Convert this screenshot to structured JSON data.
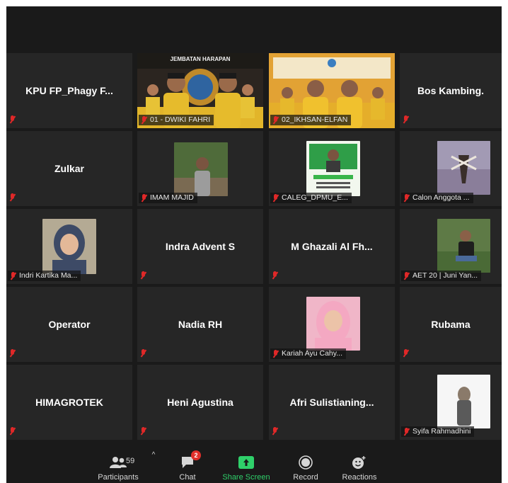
{
  "tiles": [
    {
      "name": "KPU FP_Phagy F...",
      "mode": "center"
    },
    {
      "name": "01 - DWIKI FAHRI",
      "mode": "video",
      "banner": "JEMBATAN HARAPAN"
    },
    {
      "name": "02_IKHSAN-ELFAN",
      "mode": "video2"
    },
    {
      "name": "Bos Kambing.",
      "mode": "center"
    },
    {
      "name": "Zulkar",
      "mode": "center"
    },
    {
      "name": "IMAM MAJID",
      "mode": "photo"
    },
    {
      "name": "CALEG_DPMU_E...",
      "mode": "photo"
    },
    {
      "name": "Calon Anggota ...",
      "mode": "photo"
    },
    {
      "name": "Indri Kartika Ma...",
      "mode": "photo"
    },
    {
      "name": "Indra Advent S",
      "mode": "center"
    },
    {
      "name": "M Ghazali Al Fh...",
      "mode": "center"
    },
    {
      "name": "AET 20 | Juni Yan...",
      "mode": "photo"
    },
    {
      "name": "Operator",
      "mode": "center"
    },
    {
      "name": "Nadia RH",
      "mode": "center"
    },
    {
      "name": "Kariah Ayu Cahy...",
      "mode": "photo"
    },
    {
      "name": "Rubama",
      "mode": "center"
    },
    {
      "name": "HIMAGROTEK",
      "mode": "center"
    },
    {
      "name": "Heni Agustina",
      "mode": "center"
    },
    {
      "name": "Afri Sulistianing...",
      "mode": "center"
    },
    {
      "name": "Syifa Rahmadhini",
      "mode": "photo"
    }
  ],
  "toolbar": {
    "participants_label": "Participants",
    "participants_count": "59",
    "chat_label": "Chat",
    "chat_badge": "2",
    "share_label": "Share Screen",
    "record_label": "Record",
    "reactions_label": "Reactions"
  },
  "colors": {
    "share_accent": "#2fd06a",
    "muted_mic": "#e02828",
    "badge": "#e0302b"
  }
}
